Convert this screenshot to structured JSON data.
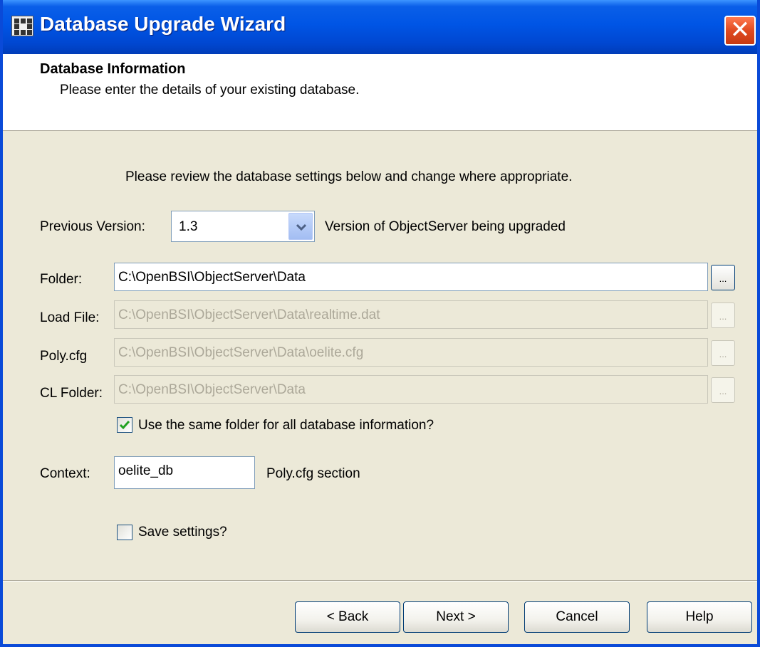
{
  "window": {
    "title": "Database Upgrade Wizard",
    "close_label": "✕"
  },
  "header": {
    "title": "Database Information",
    "subtitle": "Please enter the details of your existing database."
  },
  "review_text": "Please review the database settings below and change where appropriate.",
  "previous_version": {
    "label": "Previous Version:",
    "value": "1.3",
    "hint": "Version of  ObjectServer being upgraded"
  },
  "folder": {
    "label": "Folder:",
    "value": "C:\\OpenBSI\\ObjectServer\\Data",
    "browse_label": "..."
  },
  "load_file": {
    "label": "Load File:",
    "value": "C:\\OpenBSI\\ObjectServer\\Data\\realtime.dat",
    "browse_label": "..."
  },
  "poly_cfg": {
    "label": "Poly.cfg",
    "value": "C:\\OpenBSI\\ObjectServer\\Data\\oelite.cfg",
    "browse_label": "..."
  },
  "cl_folder": {
    "label": "CL Folder:",
    "value": "C:\\OpenBSI\\ObjectServer\\Data",
    "browse_label": "..."
  },
  "same_folder": {
    "label": "Use the same folder for all database information?",
    "checked": true
  },
  "context": {
    "label": "Context:",
    "value": "oelite_db",
    "hint": "Poly.cfg section"
  },
  "save_settings": {
    "label": "Save settings?",
    "checked": false
  },
  "buttons": {
    "back": "< Back",
    "next": "Next >",
    "cancel": "Cancel",
    "help": "Help"
  },
  "colors": {
    "titlebar": "#0055e5",
    "dialog_bg": "#ece9d8",
    "border": "#0a4ad8",
    "check": "#21a121"
  }
}
